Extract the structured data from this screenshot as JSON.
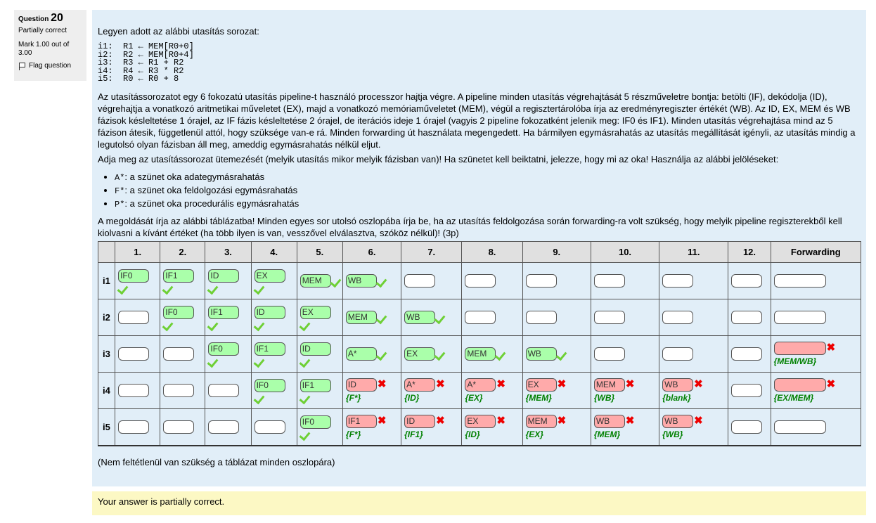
{
  "info": {
    "question_label": "Question",
    "question_number": "20",
    "state": "Partially correct",
    "grade": "Mark 1.00 out of 3.00",
    "flag_label": "Flag question"
  },
  "question": {
    "intro": "Legyen adott az alábbi utasítás sorozat:",
    "code": "i1:  R1 ← MEM[R0+0]\ni2:  R2 ← MEM[R0+4]\ni3:  R3 ← R1 + R2\ni4:  R4 ← R3 * R2\ni5:  R0 ← R0 + 8",
    "para1": "Az utasítássorozatot egy 6 fokozatú utasítás pipeline-t használó processzor hajtja végre. A pipeline minden utasítás végrehajtását 5 részműveletre bontja: betölti (IF), dekódolja (ID), végrehajtja a vonatkozó aritmetikai műveletet (EX), majd a vonatkozó memóriaműveletet (MEM), végül a regisztertárolóba írja az eredményregiszter értékét (WB). Az ID, EX, MEM és WB fázisok késleltetése 1 órajel, az IF fázis késleltetése 2 órajel, de iterációs ideje 1 órajel (vagyis 2 pipeline fokozatként jelenik meg: IF0 és IF1). Minden utasítás végrehajtása mind az 5 fázison átesik, függetlenül attól, hogy szüksége van-e rá. Minden forwarding út használata megengedett. Ha bármilyen egymásrahatás az utasítás megállítását igényli, az utasítás mindig a legutolsó olyan fázisban áll meg, ameddig egymásrahatás nélkül eljut.",
    "para2": "Adja meg az utasítássorozat ütemezését (melyik utasítás mikor melyik fázisban van)! Ha szünetet kell beiktatni, jelezze, hogy mi az oka! Használja az alábbi jelöléseket:",
    "legend": [
      {
        "code": "A*",
        "text": ": a szünet oka adategymásrahatás"
      },
      {
        "code": "F*",
        "text": ": a szünet oka feldolgozási egymásrahatás"
      },
      {
        "code": "P*",
        "text": ": a szünet oka procedurális egymásrahatás"
      }
    ],
    "para3": "A megoldását írja az alábbi táblázatba! Minden egyes sor utolsó oszlopába írja be, ha az utasítás feldolgozása során forwarding-ra volt szükség, hogy melyik pipeline regiszterekből kell kiolvasni a kívánt értéket (ha több ilyen is van, vesszővel elválasztva, szóköz nélkül)! (3p)",
    "note": "(Nem feltétlenül van szükség a táblázat minden oszlopára)"
  },
  "table": {
    "headers": [
      "",
      "1.",
      "2.",
      "3.",
      "4.",
      "5.",
      "6.",
      "7.",
      "8.",
      "9.",
      "10.",
      "11.",
      "12.",
      "Forwarding"
    ],
    "rows": [
      {
        "label": "i1",
        "cells": [
          {
            "v": "IF0",
            "s": "ok"
          },
          {
            "v": "IF1",
            "s": "ok"
          },
          {
            "v": "ID",
            "s": "ok"
          },
          {
            "v": "EX",
            "s": "ok"
          },
          {
            "v": "MEM",
            "s": "ok"
          },
          {
            "v": "WB",
            "s": "ok"
          },
          {
            "v": "",
            "s": ""
          },
          {
            "v": "",
            "s": ""
          },
          {
            "v": "",
            "s": ""
          },
          {
            "v": "",
            "s": ""
          },
          {
            "v": "",
            "s": ""
          },
          {
            "v": "",
            "s": ""
          },
          {
            "v": "",
            "s": ""
          }
        ]
      },
      {
        "label": "i2",
        "cells": [
          {
            "v": "",
            "s": ""
          },
          {
            "v": "IF0",
            "s": "ok"
          },
          {
            "v": "IF1",
            "s": "ok"
          },
          {
            "v": "ID",
            "s": "ok"
          },
          {
            "v": "EX",
            "s": "ok"
          },
          {
            "v": "MEM",
            "s": "ok"
          },
          {
            "v": "WB",
            "s": "ok"
          },
          {
            "v": "",
            "s": ""
          },
          {
            "v": "",
            "s": ""
          },
          {
            "v": "",
            "s": ""
          },
          {
            "v": "",
            "s": ""
          },
          {
            "v": "",
            "s": ""
          },
          {
            "v": "",
            "s": ""
          }
        ]
      },
      {
        "label": "i3",
        "cells": [
          {
            "v": "",
            "s": ""
          },
          {
            "v": "",
            "s": ""
          },
          {
            "v": "IF0",
            "s": "ok"
          },
          {
            "v": "IF1",
            "s": "ok"
          },
          {
            "v": "ID",
            "s": "ok"
          },
          {
            "v": "A*",
            "s": "ok"
          },
          {
            "v": "EX",
            "s": "ok"
          },
          {
            "v": "MEM",
            "s": "ok"
          },
          {
            "v": "WB",
            "s": "ok"
          },
          {
            "v": "",
            "s": ""
          },
          {
            "v": "",
            "s": ""
          },
          {
            "v": "",
            "s": ""
          },
          {
            "v": "",
            "s": "bad",
            "fb": "{MEM/WB}"
          }
        ]
      },
      {
        "label": "i4",
        "cells": [
          {
            "v": "",
            "s": ""
          },
          {
            "v": "",
            "s": ""
          },
          {
            "v": "",
            "s": ""
          },
          {
            "v": "IF0",
            "s": "ok"
          },
          {
            "v": "IF1",
            "s": "ok"
          },
          {
            "v": "ID",
            "s": "bad",
            "fb": "{F*}"
          },
          {
            "v": "A*",
            "s": "bad",
            "fb": "{ID}"
          },
          {
            "v": "A*",
            "s": "bad",
            "fb": "{EX}"
          },
          {
            "v": "EX",
            "s": "bad",
            "fb": "{MEM}"
          },
          {
            "v": "MEM",
            "s": "bad",
            "fb": "{WB}"
          },
          {
            "v": "WB",
            "s": "bad",
            "fb": "{blank}"
          },
          {
            "v": "",
            "s": ""
          },
          {
            "v": "",
            "s": "bad",
            "fb": "{EX/MEM}"
          }
        ]
      },
      {
        "label": "i5",
        "cells": [
          {
            "v": "",
            "s": ""
          },
          {
            "v": "",
            "s": ""
          },
          {
            "v": "",
            "s": ""
          },
          {
            "v": "",
            "s": ""
          },
          {
            "v": "IF0",
            "s": "ok"
          },
          {
            "v": "IF1",
            "s": "bad",
            "fb": "{F*}"
          },
          {
            "v": "ID",
            "s": "bad",
            "fb": "{IF1}"
          },
          {
            "v": "EX",
            "s": "bad",
            "fb": "{ID}"
          },
          {
            "v": "MEM",
            "s": "bad",
            "fb": "{EX}"
          },
          {
            "v": "WB",
            "s": "bad",
            "fb": "{MEM}"
          },
          {
            "v": "WB",
            "s": "bad",
            "fb": "{WB}"
          },
          {
            "v": "",
            "s": ""
          },
          {
            "v": "",
            "s": ""
          }
        ]
      }
    ]
  },
  "feedback": "Your answer is partially correct.",
  "colors": {
    "correct_bg": "#aaffaa",
    "incorrect_bg": "#ffaaaa",
    "check": "#6ed035",
    "cross": "#ee0000",
    "feedback_text": "#008000",
    "content_bg": "#e1eef8",
    "feedback_bg": "#fcf8c4"
  }
}
